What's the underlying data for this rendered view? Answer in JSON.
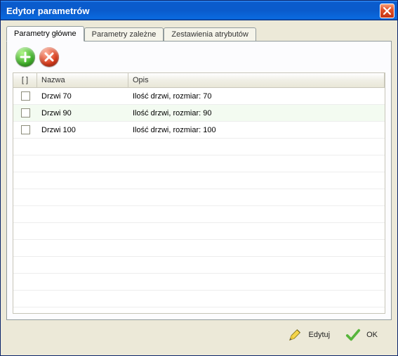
{
  "window": {
    "title": "Edytor parametrów"
  },
  "tabs": [
    {
      "label": "Parametry główne"
    },
    {
      "label": "Parametry zależne"
    },
    {
      "label": "Zestawienia atrybutów"
    }
  ],
  "table": {
    "headers": {
      "check": "[ ]",
      "name": "Nazwa",
      "desc": "Opis"
    },
    "rows": [
      {
        "name": "Drzwi 70",
        "desc": "Ilość drzwi, rozmiar: 70"
      },
      {
        "name": "Drzwi 90",
        "desc": "Ilość drzwi, rozmiar: 90"
      },
      {
        "name": "Drzwi 100",
        "desc": "Ilość drzwi, rozmiar: 100"
      }
    ]
  },
  "footer": {
    "edit": "Edytuj",
    "ok": "OK"
  }
}
